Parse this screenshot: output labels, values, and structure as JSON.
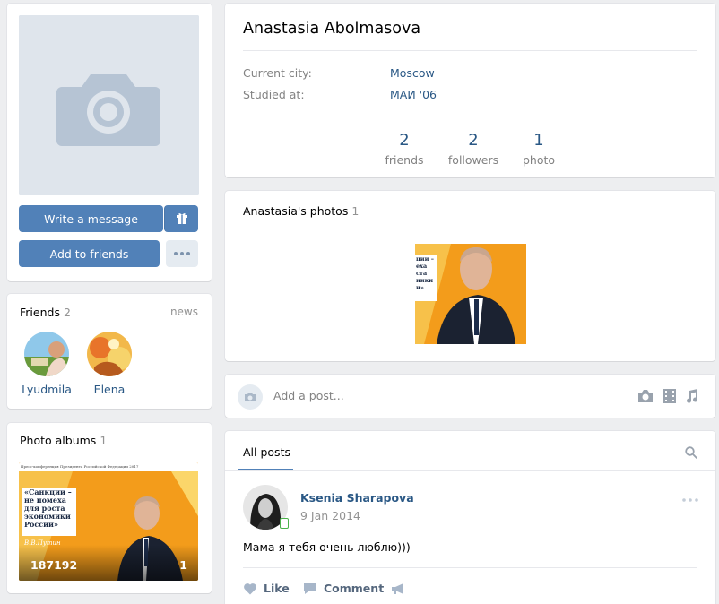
{
  "profile": {
    "name": "Anastasia Abolmasova",
    "info": [
      {
        "label": "Current city:",
        "value": "Moscow"
      },
      {
        "label": "Studied at:",
        "value": "МАИ '06"
      }
    ],
    "counters": [
      {
        "value": "2",
        "label": "friends"
      },
      {
        "value": "2",
        "label": "followers"
      },
      {
        "value": "1",
        "label": "photo"
      }
    ]
  },
  "actions": {
    "write_message": "Write a message",
    "add_to_friends": "Add to friends",
    "gift_icon": "gift-icon",
    "more_icon": "more-dots-icon"
  },
  "friends": {
    "title": "Friends",
    "count": "2",
    "news_link": "news",
    "items": [
      {
        "name": "Lyudmila"
      },
      {
        "name": "Elena"
      }
    ]
  },
  "albums": {
    "title": "Photo albums",
    "count": "1",
    "cover": {
      "album_title": "187192",
      "photo_count": "1",
      "header_text": "Пресс-конференция Президента Российской Федерации 2017",
      "slogan": "«Санкции – не помеха для роста экономики России»",
      "author": "В.В.Путин"
    }
  },
  "photos": {
    "title": "Anastasia's photos",
    "count": "1",
    "thumb_text": "ции – еха ста ники и»"
  },
  "post_box": {
    "placeholder": "Add a post...",
    "icons": [
      "camera-icon",
      "video-icon",
      "music-icon"
    ]
  },
  "wall": {
    "tab": "All posts",
    "post": {
      "author": "Ksenia Sharapova",
      "date": "9 Jan 2014",
      "text": "Мама я тебя очень люблю)))",
      "like_label": "Like",
      "comment_label": "Comment"
    }
  },
  "colors": {
    "accent": "#5181b8",
    "link": "#2a5885",
    "background": "#edeef0"
  }
}
